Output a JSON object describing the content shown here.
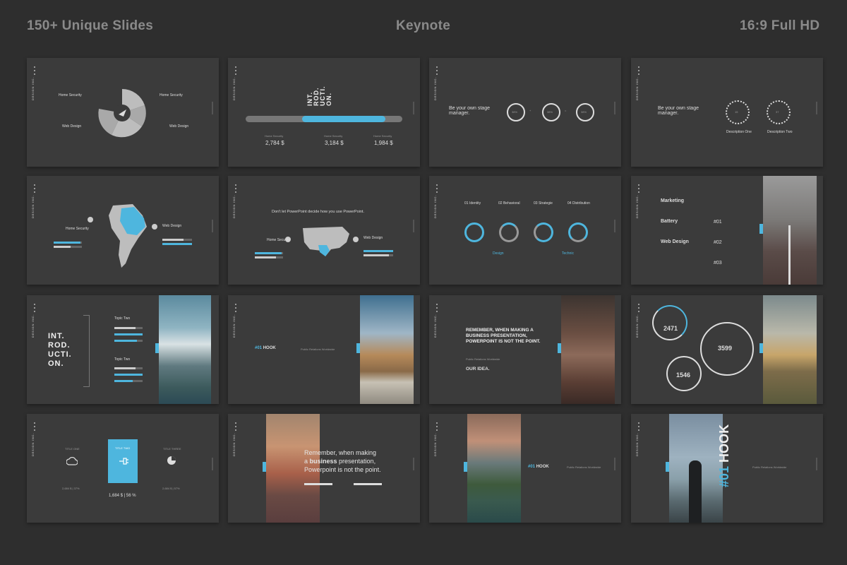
{
  "header": {
    "left": "150+ Unique Slides",
    "center": "Keynote",
    "right": "16:9 Full HD"
  },
  "brand": "DESIGN INC.",
  "colors": {
    "background": "#2e2e2e",
    "slide": "#3b3b3b",
    "accent": "#4eb6de"
  },
  "s1": {
    "home_security": "Home Security",
    "web_design": "Web Design",
    "home_security_r": "Home Security",
    "web_design_r": "Web Design"
  },
  "s2": {
    "title": [
      "INT.",
      "ROD.",
      "UCTI.",
      "ON."
    ],
    "items": [
      {
        "label": "Home Security",
        "value": "2,784 $"
      },
      {
        "label": "Home Security",
        "value": "3,184 $"
      },
      {
        "label": "Home Security",
        "value": "1,984 $"
      }
    ]
  },
  "s3": {
    "heading": "Be your own stage manager.",
    "c1": "38%",
    "c2": "38%",
    "c3": "38%",
    "op_plus": "+",
    "op_eq": "="
  },
  "s4": {
    "heading": "Be your own stage manager.",
    "d1": "Description One",
    "d2": "Description Two",
    "c1": "15",
    "c2": "37"
  },
  "s5": {
    "home_security": "Home Security",
    "web_design": "Web Design"
  },
  "s6": {
    "tagline": "Don't let PowerPoint decide how you use PowerPoint.",
    "home_security": "Home Security",
    "web_design": "Web Design"
  },
  "s7": {
    "labels": [
      "01 Identity",
      "02 Behavioral",
      "03 Strategie",
      "04 Distribution"
    ],
    "design": "Design",
    "technic": "Technic"
  },
  "s8": {
    "items": [
      "Marketing",
      "Battery",
      "Web Design"
    ],
    "nums": [
      "#01",
      "#02",
      "#03"
    ]
  },
  "s9": {
    "title": [
      "INT.",
      "ROD.",
      "UCTI.",
      "ON."
    ],
    "topic1": "Topic Two",
    "topic2": "Topic Two"
  },
  "s10": {
    "num": "#01",
    "hook": "HOOK",
    "sub": "Public Relations Worldwide"
  },
  "s11": {
    "headline": "REMEMBER, WHEN MAKING A BUSINESS PRESENTATION, POWERPOINT IS NOT THE POINT.",
    "sub": "Public Relations Worldwide",
    "idea": "OUR IDEA."
  },
  "s12": {
    "v1": "2471",
    "v2": "3599",
    "v3": "1546"
  },
  "s13": {
    "t1": "TITLE ONE",
    "t2": "TITLE TWO",
    "t3": "TITLE THREE",
    "v1": "2,684 $ | 37%",
    "v2": "1,684 $ | 56 %",
    "v3": "2,684 $ | 57%"
  },
  "s14": {
    "line1": "Remember, when making",
    "line2a": "a ",
    "line2b": "business",
    "line2c": " presentation,",
    "line3": "Powerpoint is not the point."
  },
  "s15": {
    "num": "#01",
    "hook": "HOOK",
    "sub": "Public Relations Worldwide"
  },
  "s16": {
    "num": "#01",
    "hook": "HOOK",
    "sub": "Public Relations Worldwide"
  }
}
